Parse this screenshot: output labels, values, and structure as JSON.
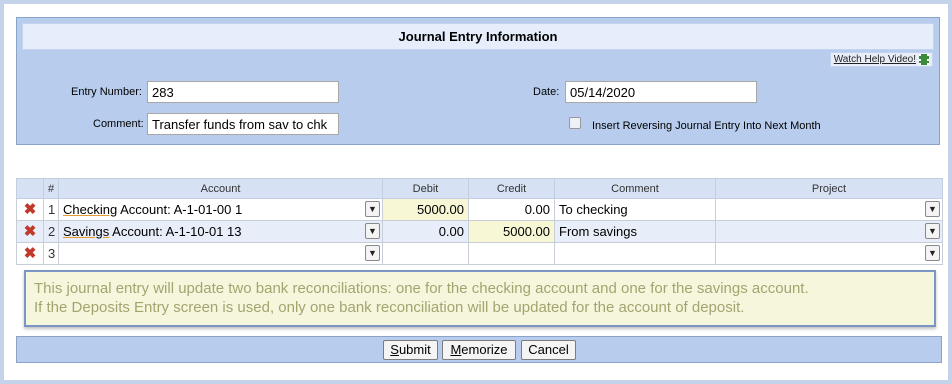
{
  "panel": {
    "title": "Journal Entry Information",
    "help_link": "Watch Help Video!",
    "entry_number_label": "Entry Number:",
    "entry_number_value": "283",
    "comment_label": "Comment:",
    "comment_value": "Transfer funds from sav to chk",
    "date_label": "Date:",
    "date_value": "05/14/2020",
    "reversing_label": "Insert Reversing Journal Entry Into Next Month",
    "reversing_checked": false
  },
  "grid": {
    "headers": [
      "#",
      "Account",
      "Debit",
      "Credit",
      "Comment",
      "Project"
    ],
    "rows": [
      {
        "num": "1",
        "account_name": "Checking",
        "account_rest": " Account: A-1-01-00 1",
        "debit": "5000.00",
        "credit": "0.00",
        "comment": "To checking",
        "project": ""
      },
      {
        "num": "2",
        "account_name": "Savings",
        "account_rest": " Account: A-1-10-01 13",
        "debit": "0.00",
        "credit": "5000.00",
        "comment": "From savings",
        "project": ""
      },
      {
        "num": "3",
        "account_name": "",
        "account_rest": "",
        "debit": "",
        "credit": "",
        "comment": "",
        "project": ""
      }
    ]
  },
  "notice": {
    "line1": "This journal entry will update two bank reconciliations: one for the checking account and one for the savings account.",
    "line2": "If the Deposits Entry screen is used, only one bank reconciliation will be updated for the account of deposit."
  },
  "buttons": {
    "submit_u": "S",
    "submit_rest": "ubmit",
    "memorize_u": "M",
    "memorize_rest": "emorize",
    "cancel": "Cancel"
  },
  "icons": {
    "delete": "delete-x-icon",
    "dropdown": "chevron-down-icon",
    "help_video": "film-icon"
  },
  "colors": {
    "panel_bg": "#b8cdee",
    "delete_icon": "#c0392b",
    "notice_text": "#a4a471"
  }
}
